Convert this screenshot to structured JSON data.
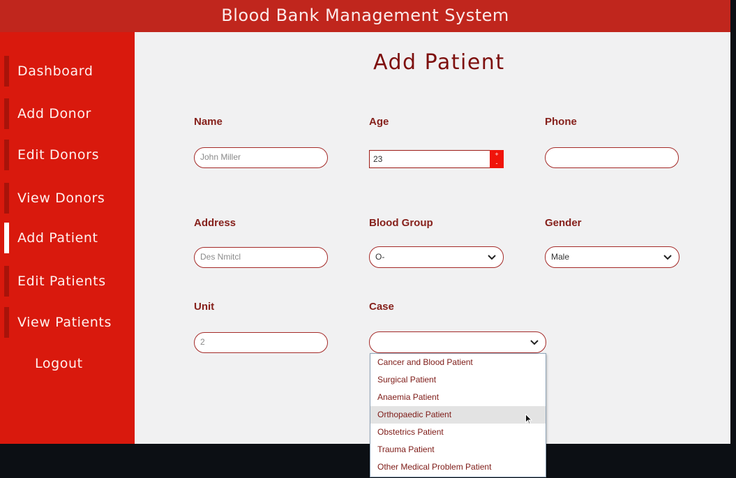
{
  "app": {
    "title": "Blood Bank Management System"
  },
  "sidebar": {
    "items": [
      {
        "label": "Dashboard"
      },
      {
        "label": "Add Donor"
      },
      {
        "label": "Edit Donors"
      },
      {
        "label": "View Donors"
      },
      {
        "label": "Add Patient",
        "active": true
      },
      {
        "label": "Edit Patients"
      },
      {
        "label": "View Patients"
      }
    ],
    "logout_label": "Logout"
  },
  "form": {
    "title": "Add Patient",
    "name": {
      "label": "Name",
      "value": "John Miller"
    },
    "age": {
      "label": "Age",
      "value": "23",
      "increment": "+",
      "decrement": "-"
    },
    "phone": {
      "label": "Phone",
      "value": ""
    },
    "address": {
      "label": "Address",
      "value": "Des Nmitcl"
    },
    "blood_group": {
      "label": "Blood Group",
      "selected": "O-"
    },
    "gender": {
      "label": "Gender",
      "selected": "Male"
    },
    "unit": {
      "label": "Unit",
      "value": "2"
    },
    "case": {
      "label": "Case",
      "selected": "",
      "expanded": true,
      "hovered_option": "Orthopaedic Patient",
      "options": [
        "Cancer and Blood Patient",
        "Surgical Patient",
        "Anaemia Patient",
        "Orthopaedic Patient",
        "Obstetrics Patient",
        "Trauma Patient",
        "Other Medical Problem Patient"
      ]
    }
  },
  "colors": {
    "titlebar": "#c0261d",
    "sidebar": "#d9190d",
    "accent_dark": "#7d0f0d",
    "field_border": "#a42a28",
    "spinner": "#f0140a",
    "background": "#f1f1f2"
  }
}
